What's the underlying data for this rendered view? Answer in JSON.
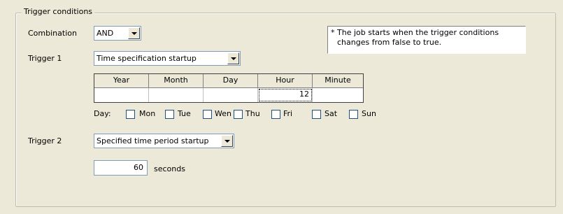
{
  "group": {
    "title": "Trigger conditions"
  },
  "combination": {
    "label": "Combination",
    "value": "AND"
  },
  "note": {
    "line1": "* The job starts when the trigger conditions",
    "line2": "changes from false to true."
  },
  "trigger1": {
    "label": "Trigger 1",
    "value": "Time specification startup",
    "headers": [
      "Year",
      "Month",
      "Day",
      "Hour",
      "Minute"
    ],
    "values": [
      "",
      "",
      "",
      "12",
      ""
    ]
  },
  "days": {
    "label": "Day:",
    "items": [
      {
        "label": "Mon",
        "checked": false
      },
      {
        "label": "Tue",
        "checked": false
      },
      {
        "label": "Wen",
        "checked": false
      },
      {
        "label": "Thu",
        "checked": false
      },
      {
        "label": "Fri",
        "checked": false
      },
      {
        "label": "Sat",
        "checked": false
      },
      {
        "label": "Sun",
        "checked": false
      }
    ]
  },
  "trigger2": {
    "label": "Trigger 2",
    "value": "Specified time period startup",
    "seconds_value": "60",
    "seconds_label": "seconds"
  }
}
